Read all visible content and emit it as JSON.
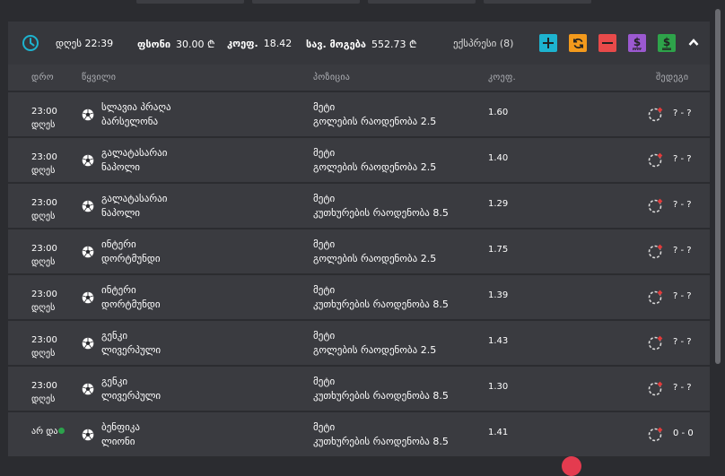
{
  "header": {
    "date_label": "დღეს 22:39",
    "stake_label": "ფსონი",
    "stake_value": "30.00 ₾",
    "odds_label": "კოეფ.",
    "odds_value": "18.42",
    "possible_win_label": "სავ. მოგება",
    "possible_win_value": "552.73 ₾",
    "express_label": "ექსპრესი (8)",
    "colors": {
      "add": "#1db3cf",
      "refresh": "#f39a1c",
      "remove": "#e84a4a",
      "dollar": "#9b59d0",
      "cashout": "#2ea34a"
    },
    "icons": [
      "plus-icon",
      "refresh-icon",
      "minus-icon",
      "dollar-icon",
      "cashout-icon",
      "chevron-up-icon"
    ]
  },
  "columns": {
    "time": "დრო",
    "match": "წყვილი",
    "position": "პოზიცია",
    "odds": "კოეფ.",
    "result": "შედეგი"
  },
  "bets": [
    {
      "time": "23:00",
      "day": "დღეს",
      "home": "სლავია პრაღა",
      "away": "ბარსელონა",
      "pick": "მეტი",
      "market": "გოლების რაოდენობა 2.5",
      "odds": "1.60",
      "score": "? - ?",
      "live": false
    },
    {
      "time": "23:00",
      "day": "დღეს",
      "home": "გალატასარაი",
      "away": "ნაპოლი",
      "pick": "მეტი",
      "market": "გოლების რაოდენობა 2.5",
      "odds": "1.40",
      "score": "? - ?",
      "live": false
    },
    {
      "time": "23:00",
      "day": "დღეს",
      "home": "გალატასარაი",
      "away": "ნაპოლი",
      "pick": "მეტი",
      "market": "კუთხურების რაოდენობა 8.5",
      "odds": "1.29",
      "score": "? - ?",
      "live": false
    },
    {
      "time": "23:00",
      "day": "დღეს",
      "home": "ინტერი",
      "away": "დორტმუნდი",
      "pick": "მეტი",
      "market": "გოლების რაოდენობა 2.5",
      "odds": "1.75",
      "score": "? - ?",
      "live": false
    },
    {
      "time": "23:00",
      "day": "დღეს",
      "home": "ინტერი",
      "away": "დორტმუნდი",
      "pick": "მეტი",
      "market": "კუთხურების რაოდენობა 8.5",
      "odds": "1.39",
      "score": "? - ?",
      "live": false
    },
    {
      "time": "23:00",
      "day": "დღეს",
      "home": "გენკი",
      "away": "ლივერპული",
      "pick": "მეტი",
      "market": "გოლების რაოდენობა 2.5",
      "odds": "1.43",
      "score": "? - ?",
      "live": false
    },
    {
      "time": "23:00",
      "day": "დღეს",
      "home": "გენკი",
      "away": "ლივერპული",
      "pick": "მეტი",
      "market": "კუთხურების რაოდენობა 8.5",
      "odds": "1.30",
      "score": "? - ?",
      "live": false
    },
    {
      "time": "",
      "day": "არ და",
      "home": "ბენფიკა",
      "away": "ლიონი",
      "pick": "მეტი",
      "market": "კუთხურების რაოდენობა 8.5",
      "odds": "1.41",
      "score": "0 - 0",
      "live": true
    }
  ]
}
